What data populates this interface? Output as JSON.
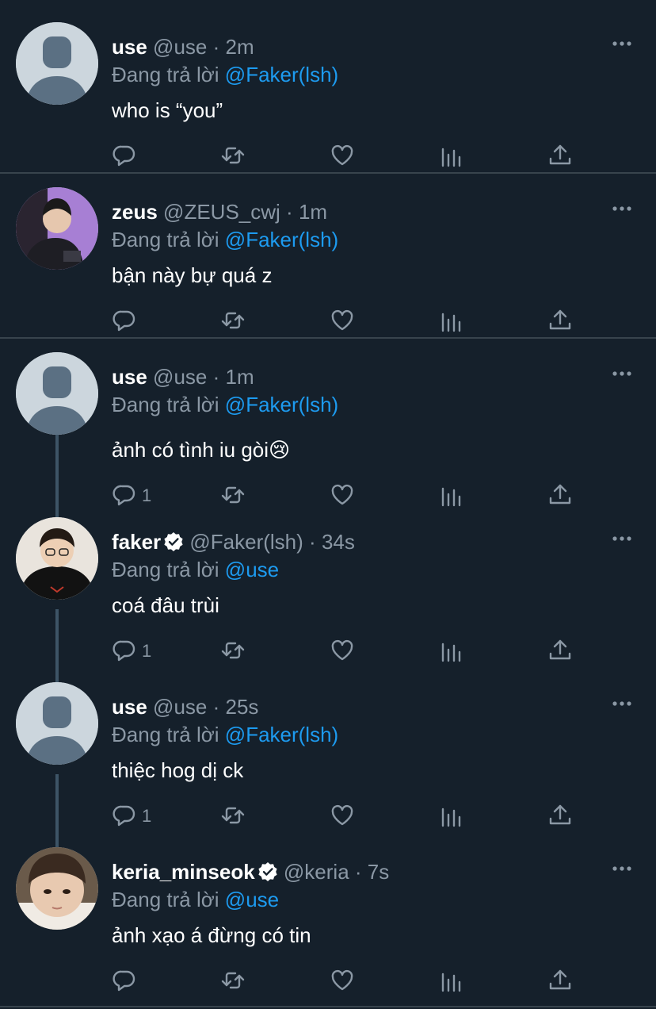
{
  "replying_prefix": "Đang trả lời",
  "tweets": [
    {
      "name": "use",
      "handle": "@use",
      "time": "2m",
      "replying_to": "@Faker(lsh)",
      "text": "who is “you”",
      "reply_count": "",
      "verified": false,
      "avatar": "default-avatar"
    },
    {
      "name": "zeus",
      "handle": "@ZEUS_cwj",
      "time": "1m",
      "replying_to": "@Faker(lsh)",
      "text": "bận này bự quá z",
      "reply_count": "",
      "verified": false,
      "avatar": "zeus-photo"
    },
    {
      "name": "use",
      "handle": "@use",
      "time": "1m",
      "replying_to": "@Faker(lsh)",
      "text": "ảnh có tình iu gòi😢",
      "reply_count": "1",
      "verified": false,
      "avatar": "default-avatar"
    },
    {
      "name": "faker",
      "handle": "@Faker(lsh)",
      "time": "34s",
      "replying_to": "@use",
      "text": "coá đâu trùi",
      "reply_count": "1",
      "verified": true,
      "avatar": "faker-photo"
    },
    {
      "name": "use",
      "handle": "@use",
      "time": "25s",
      "replying_to": "@Faker(lsh)",
      "text": "thiệc hog dị ck",
      "reply_count": "1",
      "verified": false,
      "avatar": "default-avatar"
    },
    {
      "name": "keria_minseok",
      "handle": "@keria",
      "time": "7s",
      "replying_to": "@use",
      "text": "ảnh xạo á đừng có tin",
      "reply_count": "",
      "verified": true,
      "avatar": "keria-photo"
    }
  ],
  "separator": "·",
  "colors": {
    "background": "#15202b",
    "accent": "#1d9bf0",
    "muted": "#8b98a5",
    "divider": "#38444d"
  }
}
